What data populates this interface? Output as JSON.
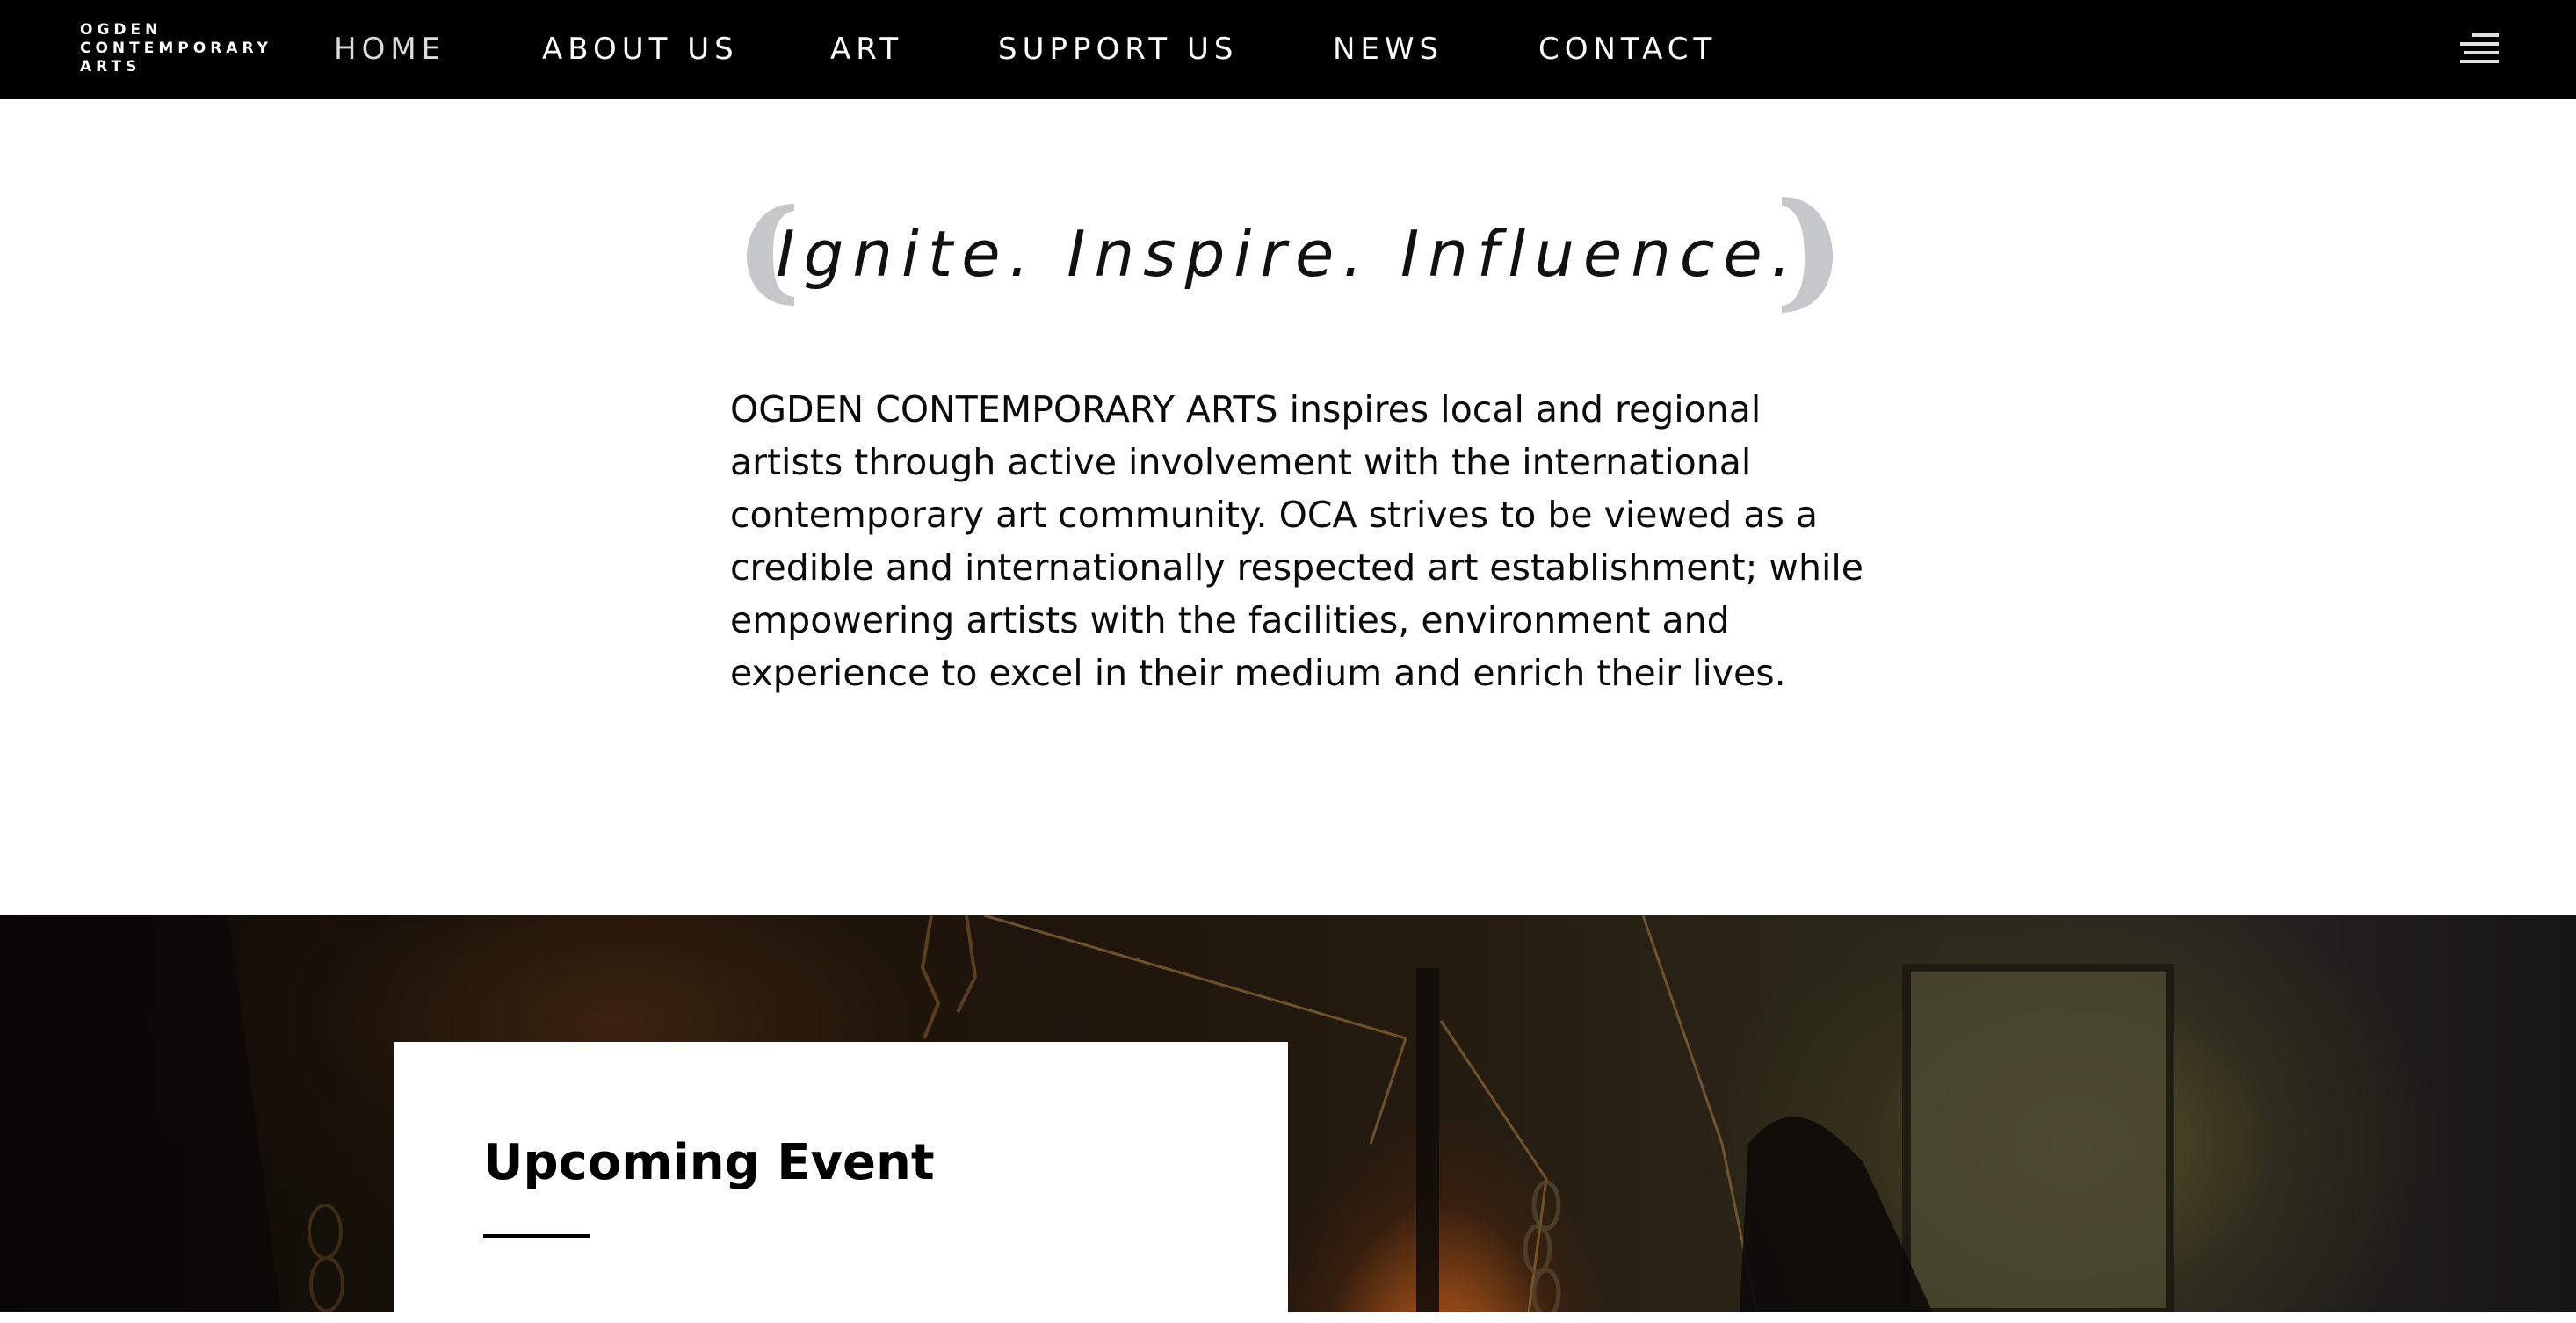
{
  "nav": {
    "logo_lines": [
      "OGDEN",
      "CONTEMPORARY",
      "ARTS"
    ],
    "items": [
      {
        "label": "HOME",
        "active": true
      },
      {
        "label": "ABOUT US",
        "active": false
      },
      {
        "label": "ART",
        "active": false
      },
      {
        "label": "SUPPORT US",
        "active": false
      },
      {
        "label": "NEWS",
        "active": false
      },
      {
        "label": "CONTACT",
        "active": false
      }
    ],
    "menu_icon": "hamburger-menu-icon"
  },
  "intro": {
    "tagline": "Ignite. Inspire. Influence.",
    "mission_lines": [
      "OGDEN CONTEMPORARY ARTS inspires local and regional",
      "artists through active involvement with the international",
      "contemporary art community. OCA strives to be viewed as a",
      "credible and internationally respected art establishment; while",
      "empowering artists with the facilities, environment and",
      "experience to excel in their medium and enrich their lives."
    ]
  },
  "event": {
    "heading": "Upcoming Event"
  },
  "colors": {
    "nav_background": "#000000",
    "bracket_gray": "#c4c8cb",
    "text": "#0b0b0b"
  }
}
